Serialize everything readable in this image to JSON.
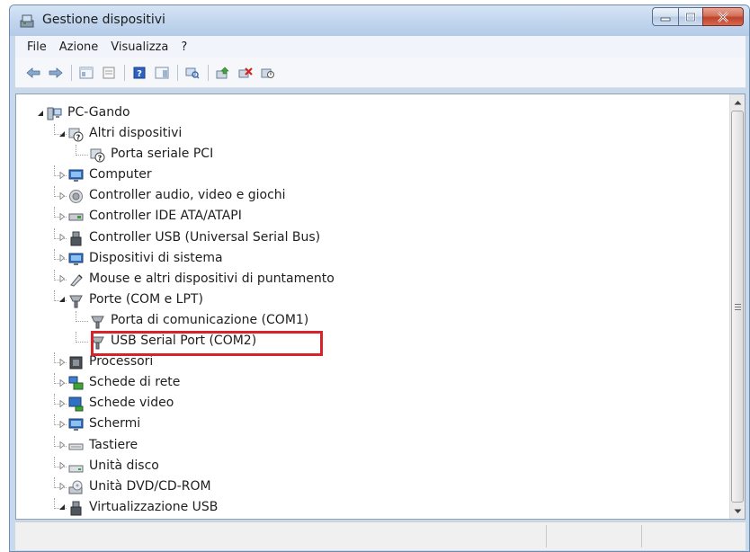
{
  "window": {
    "title": "Gestione dispositivi",
    "icon": "device-manager-icon"
  },
  "caption_buttons": [
    {
      "name": "minimize",
      "icon": "minimize-icon"
    },
    {
      "name": "maximize",
      "icon": "maximize-icon"
    },
    {
      "name": "close",
      "icon": "close-icon"
    }
  ],
  "menu": {
    "file": "File",
    "azione": "Azione",
    "visualizza": "Visualizza",
    "help": "?"
  },
  "toolbar": [
    {
      "name": "back",
      "icon": "back-arrow-icon"
    },
    {
      "name": "forward",
      "icon": "forward-arrow-icon"
    },
    {
      "name": "show-hide-console-tree",
      "icon": "console-tree-icon"
    },
    {
      "name": "properties",
      "icon": "properties-icon"
    },
    {
      "name": "help",
      "icon": "help-icon"
    },
    {
      "name": "show-action-pane",
      "icon": "action-pane-icon"
    },
    {
      "name": "scan-hardware",
      "icon": "scan-hardware-icon"
    },
    {
      "name": "update-driver",
      "icon": "update-driver-icon"
    },
    {
      "name": "uninstall-device",
      "icon": "uninstall-icon"
    },
    {
      "name": "disable-device",
      "icon": "disable-device-icon"
    }
  ],
  "tree": {
    "root": "PC-Gando",
    "items": [
      {
        "label": "PC-Gando",
        "level": 0,
        "state": "expanded",
        "icon": "computer-icon"
      },
      {
        "label": "Altri dispositivi",
        "level": 1,
        "state": "expanded",
        "icon": "unknown-device-icon"
      },
      {
        "label": "Porta seriale PCI",
        "level": 2,
        "state": "leaf",
        "icon": "unknown-device-icon"
      },
      {
        "label": "Computer",
        "level": 1,
        "state": "collapsed",
        "icon": "monitor-icon"
      },
      {
        "label": "Controller audio, video e giochi",
        "level": 1,
        "state": "collapsed",
        "icon": "speaker-icon"
      },
      {
        "label": "Controller IDE ATA/ATAPI",
        "level": 1,
        "state": "collapsed",
        "icon": "ide-controller-icon"
      },
      {
        "label": "Controller USB (Universal Serial Bus)",
        "level": 1,
        "state": "collapsed",
        "icon": "usb-icon"
      },
      {
        "label": "Dispositivi di sistema",
        "level": 1,
        "state": "collapsed",
        "icon": "monitor-icon"
      },
      {
        "label": "Mouse e altri dispositivi di puntamento",
        "level": 1,
        "state": "collapsed",
        "icon": "mouse-icon"
      },
      {
        "label": "Porte (COM e LPT)",
        "level": 1,
        "state": "expanded",
        "icon": "port-icon"
      },
      {
        "label": "Porta di comunicazione (COM1)",
        "level": 2,
        "state": "leaf",
        "icon": "port-icon"
      },
      {
        "label": "USB Serial Port (COM2)",
        "level": 2,
        "state": "leaf",
        "icon": "port-icon",
        "selected": true
      },
      {
        "label": "Processori",
        "level": 1,
        "state": "collapsed",
        "icon": "processor-icon"
      },
      {
        "label": "Schede di rete",
        "level": 1,
        "state": "collapsed",
        "icon": "network-icon"
      },
      {
        "label": "Schede video",
        "level": 1,
        "state": "collapsed",
        "icon": "display-adapter-icon"
      },
      {
        "label": "Schermi",
        "level": 1,
        "state": "collapsed",
        "icon": "monitor-icon"
      },
      {
        "label": "Tastiere",
        "level": 1,
        "state": "collapsed",
        "icon": "keyboard-icon"
      },
      {
        "label": "Unità disco",
        "level": 1,
        "state": "collapsed",
        "icon": "disk-drive-icon"
      },
      {
        "label": "Unità DVD/CD-ROM",
        "level": 1,
        "state": "collapsed",
        "icon": "dvd-drive-icon"
      },
      {
        "label": "Virtualizzazione USB",
        "level": 1,
        "state": "expanded",
        "icon": "usb-icon"
      }
    ]
  },
  "colors": {
    "highlight_box": "#d8232a",
    "title_bar": "#c2d6ee",
    "close_button": "#c0422b"
  }
}
